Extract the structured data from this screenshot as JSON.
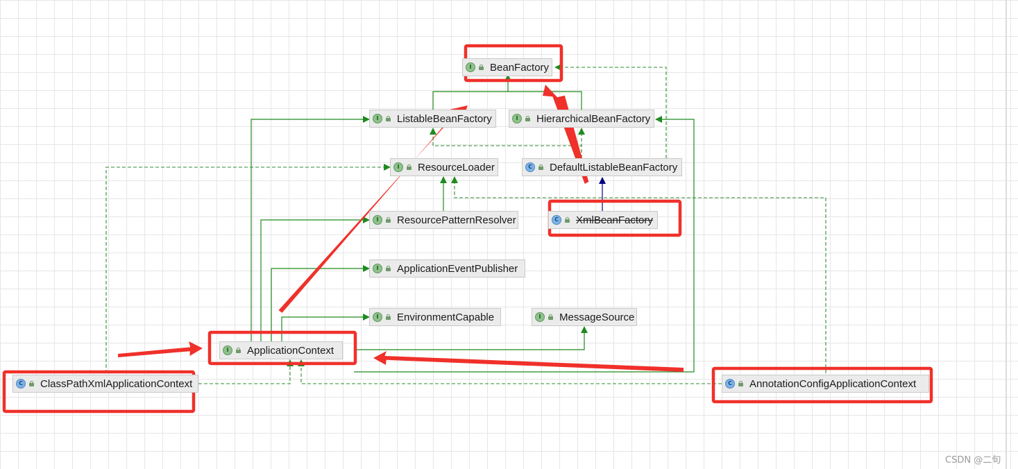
{
  "diagram": {
    "nodes": [
      {
        "id": "bean-factory",
        "label": "BeanFactory",
        "kind": "interface",
        "badge": "I"
      },
      {
        "id": "listable-bean-factory",
        "label": "ListableBeanFactory",
        "kind": "interface",
        "badge": "I"
      },
      {
        "id": "hierarchical-bean-factory",
        "label": "HierarchicalBeanFactory",
        "kind": "interface",
        "badge": "I"
      },
      {
        "id": "resource-loader",
        "label": "ResourceLoader",
        "kind": "interface",
        "badge": "I"
      },
      {
        "id": "default-listable-bean-factory",
        "label": "DefaultListableBeanFactory",
        "kind": "class",
        "badge": "C"
      },
      {
        "id": "resource-pattern-resolver",
        "label": "ResourcePatternResolver",
        "kind": "interface",
        "badge": "I"
      },
      {
        "id": "xml-bean-factory",
        "label": "XmlBeanFactory",
        "kind": "class",
        "badge": "C",
        "deprecated": true
      },
      {
        "id": "application-event-publisher",
        "label": "ApplicationEventPublisher",
        "kind": "interface",
        "badge": "I"
      },
      {
        "id": "environment-capable",
        "label": "EnvironmentCapable",
        "kind": "interface",
        "badge": "I"
      },
      {
        "id": "message-source",
        "label": "MessageSource",
        "kind": "interface",
        "badge": "I"
      },
      {
        "id": "application-context",
        "label": "ApplicationContext",
        "kind": "interface",
        "badge": "I"
      },
      {
        "id": "classpath-xml-application-context",
        "label": "ClassPathXmlApplicationContext",
        "kind": "class",
        "badge": "C"
      },
      {
        "id": "annotation-config-application-context",
        "label": "AnnotationConfigApplicationContext",
        "kind": "class",
        "badge": "C"
      }
    ],
    "colors": {
      "extends": "#1f8a1f",
      "implements": "#2e8b2e",
      "class_extends": "#000080",
      "highlight": "#f0302a"
    }
  },
  "watermark": "CSDN @二旬"
}
